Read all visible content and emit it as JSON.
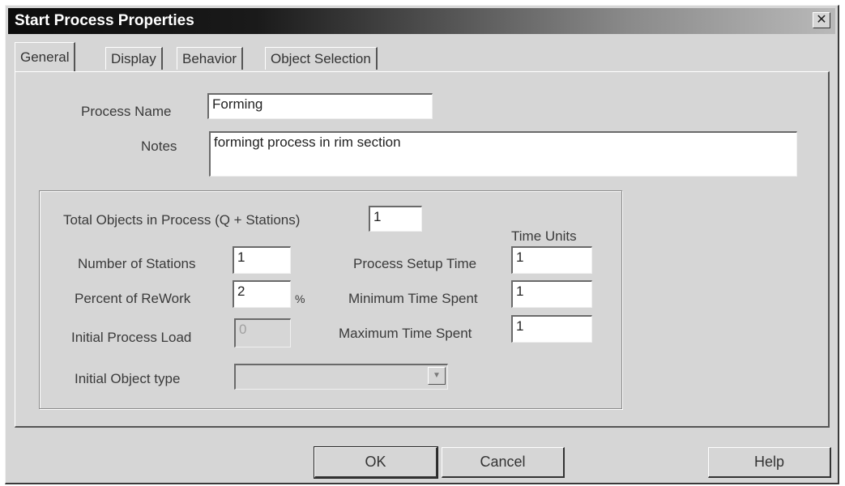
{
  "window": {
    "title": "Start Process Properties",
    "close_glyph": "✕"
  },
  "tabs": [
    {
      "label": "General"
    },
    {
      "label": "Display"
    },
    {
      "label": "Behavior"
    },
    {
      "label": "Object Selection"
    }
  ],
  "general": {
    "process_name_label": "Process Name",
    "process_name_value": "Forming",
    "notes_label": "Notes",
    "notes_value": "formingt process in  rim section"
  },
  "group": {
    "total_objects_label": "Total Objects in Process (Q + Stations)",
    "total_objects_value": "1",
    "time_units_label": "Time Units",
    "num_stations_label": "Number of Stations",
    "num_stations_value": "1",
    "percent_rework_label": "Percent of ReWork",
    "percent_rework_value": "2",
    "percent_symbol": "%",
    "initial_load_label": "Initial Process Load",
    "initial_load_value": "0",
    "setup_time_label": "Process Setup Time",
    "setup_time_value": "1",
    "min_time_label": "Minimum Time Spent",
    "min_time_value": "1",
    "max_time_label": "Maximum Time Spent",
    "max_time_value": "1",
    "initial_object_type_label": "Initial Object type",
    "initial_object_type_value": ""
  },
  "buttons": {
    "ok": "OK",
    "cancel": "Cancel",
    "help": "Help"
  },
  "icons": {
    "dropdown": "chevron-down-icon",
    "close": "close-icon"
  }
}
